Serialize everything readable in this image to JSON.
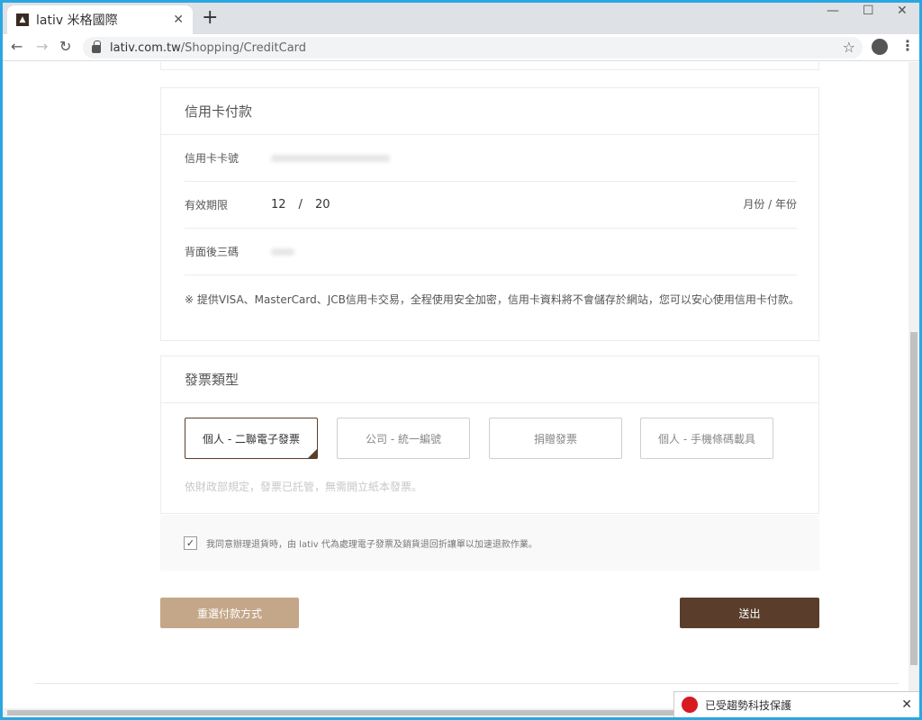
{
  "browser": {
    "tab_title": "lativ 米格國際",
    "new_tab": "+",
    "tab_close": "✕",
    "url_host": "lativ.com.tw",
    "url_path": "/Shopping/CreditCard",
    "window_minimize": "—",
    "window_maximize": "☐",
    "window_close": "✕"
  },
  "credit_card": {
    "title": "信用卡付款",
    "card_number_label": "信用卡卡號",
    "expiry_label": "有效期限",
    "expiry_month": "12",
    "expiry_sep": "/",
    "expiry_year": "20",
    "expiry_unit": "月份 / 年份",
    "cvv_label": "背面後三碼",
    "note": "※ 提供VISA、MasterCard、JCB信用卡交易，全程使用安全加密，信用卡資料將不會儲存於網站，您可以安心使用信用卡付款。"
  },
  "invoice": {
    "title": "發票類型",
    "options": [
      "個人 - 二聯電子發票",
      "公司 - 統一編號",
      "捐贈發票",
      "個人 - 手機條碼載具"
    ],
    "selected_index": 0,
    "note": "依財政部規定，發票已託管，無需開立紙本發票。"
  },
  "agree": {
    "checked": true,
    "text": "我同意辦理退貨時，由 lativ 代為處理電子發票及銷貨退回折讓單以加速退款作業。"
  },
  "actions": {
    "back_label": "重選付款方式",
    "submit_label": "送出"
  },
  "toast": {
    "text": "已受趨勢科技保護"
  },
  "colors": {
    "brand_dark": "#5a3e2b",
    "brand_light": "#c4a789"
  }
}
